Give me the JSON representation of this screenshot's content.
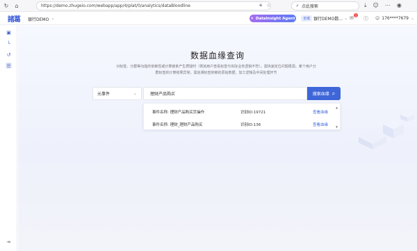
{
  "browser": {
    "url": "https://demo.zhugeio.com/webapp/app/4/plat/0/analytics/dataBloodline",
    "search_placeholder": "点此搜索"
  },
  "header": {
    "logo": "諸葛",
    "workspace": "银行DEMO",
    "agent_label": "DataInsight Agent",
    "env_tag": "全域",
    "env_name": "银行DEMO数...",
    "notification_count": "1",
    "user": "176****7679"
  },
  "main": {
    "title": "数据血缘查询",
    "description": "对标签、分群等功能的依赖性或计算链条产生质疑时（例如用户查看标签与实际业务逻辑不符），需快速定位问题根源。某个用户分群标签的计算结果异常，需追溯标签依赖的原始数据、加工逻辑及中间处理环节",
    "type_select": "元事件",
    "query_value": "理财产品购买",
    "query_button": "搜索血缘",
    "results": [
      {
        "event": "事件名称: 理财产品购买页操作",
        "id": "识别ID:19721",
        "link": "查看血缘"
      },
      {
        "event": "事件名称: 理财_理财产品购买",
        "id": "识别ID:136",
        "link": "查看血缘"
      }
    ]
  },
  "colors": {
    "accent": "#3f66d9",
    "agent_gradient_start": "#a66cf0",
    "agent_gradient_end": "#5b7bf4"
  }
}
